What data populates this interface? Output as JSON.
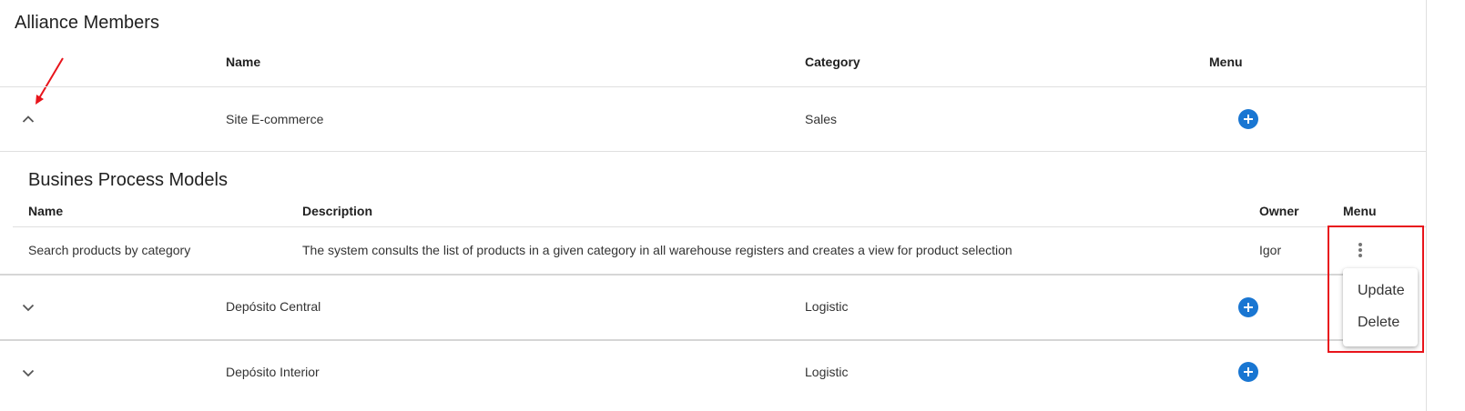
{
  "page": {
    "title": "Alliance Members"
  },
  "members_table": {
    "headers": {
      "name": "Name",
      "category": "Category",
      "menu": "Menu"
    },
    "rows": [
      {
        "name": "Site E-commerce",
        "category": "Sales",
        "expanded": true
      },
      {
        "name": "Depósito Central",
        "category": "Logistic",
        "expanded": false
      },
      {
        "name": "Depósito Interior",
        "category": "Logistic",
        "expanded": false
      }
    ]
  },
  "process_models": {
    "title": "Busines Process Models",
    "headers": {
      "name": "Name",
      "description": "Description",
      "owner": "Owner",
      "menu": "Menu"
    },
    "rows": [
      {
        "name": "Search products by category",
        "description": "The system consults the list of products in a given category in all warehouse registers and creates a view for product selection",
        "owner": "Igor"
      }
    ]
  },
  "row_menu": {
    "items": [
      "Update",
      "Delete"
    ]
  },
  "icons": {
    "expand": "chevron-down-icon",
    "collapse": "chevron-up-icon",
    "add": "add-circle-icon",
    "more": "more-vertical-icon"
  },
  "colors": {
    "accent": "#1976d2",
    "annotation": "#e8141b",
    "divider": "#e0e0e0"
  }
}
